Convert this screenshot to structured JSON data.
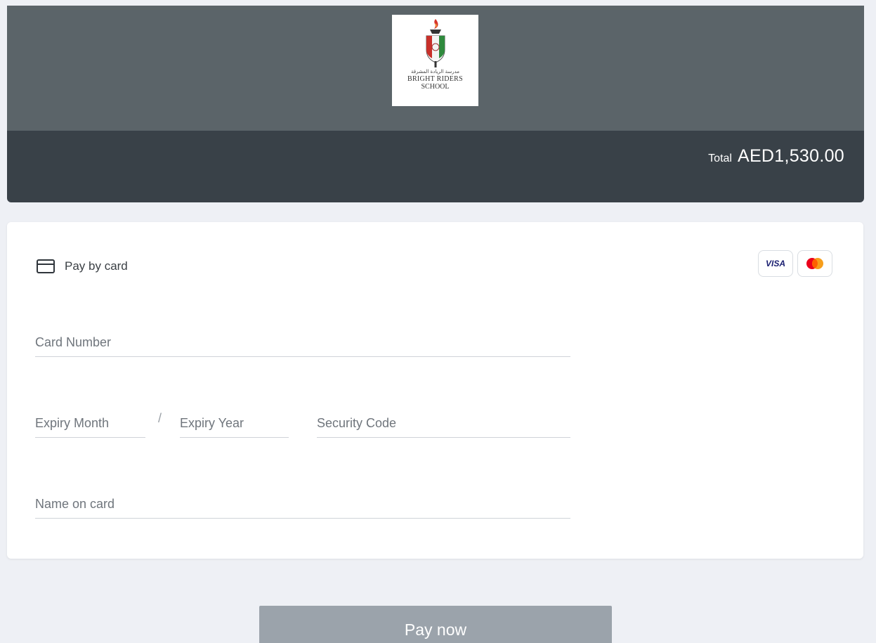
{
  "header": {
    "logo": {
      "arabic_text": "مدرسة الريادة المشرقة",
      "line1": "BRIGHT RIDERS",
      "line2": "SCHOOL"
    },
    "total_label": "Total",
    "total_amount": "AED1,530.00"
  },
  "payment": {
    "method_label": "Pay by card",
    "method_icon": "credit-card-icon",
    "brands": [
      {
        "name": "VISA",
        "icon": "visa-icon"
      },
      {
        "name": "Mastercard",
        "icon": "mastercard-icon"
      }
    ],
    "fields": {
      "card_number": {
        "placeholder": "Card Number",
        "value": ""
      },
      "expiry_month": {
        "placeholder": "Expiry Month",
        "value": ""
      },
      "expiry_separator": "/",
      "expiry_year": {
        "placeholder": "Expiry Year",
        "value": ""
      },
      "security_code": {
        "placeholder": "Security Code",
        "value": ""
      },
      "name_on_card": {
        "placeholder": "Name on card",
        "value": ""
      }
    }
  },
  "actions": {
    "pay_label": "Pay now"
  },
  "colors": {
    "page_background": "#eef0f5",
    "header_top": "#5b6469",
    "header_bottom": "#394148",
    "pay_button": "#9ba3ab",
    "visa_blue": "#1a1f71",
    "mastercard_red": "#eb001b",
    "mastercard_orange": "#f79e1b"
  }
}
